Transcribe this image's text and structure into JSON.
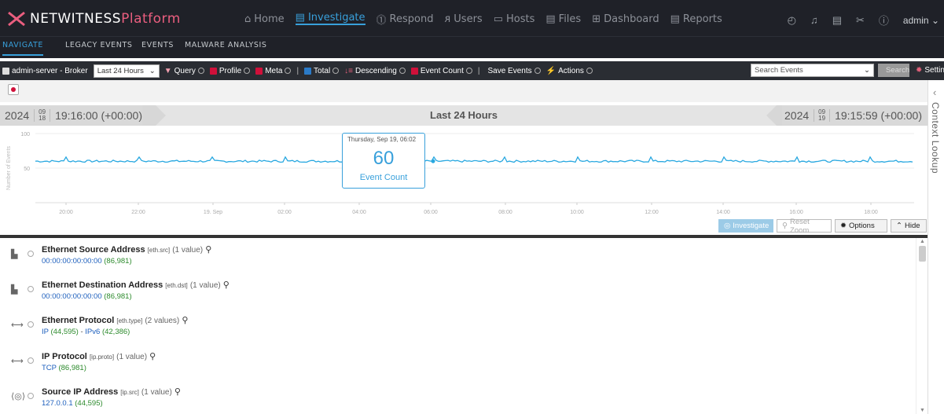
{
  "brand": {
    "name": "NETWITNESS",
    "platform": "Platform"
  },
  "mainnav": [
    {
      "label": "Home",
      "icon": "home-icon"
    },
    {
      "label": "Investigate",
      "icon": "investigate-icon"
    },
    {
      "label": "Respond",
      "icon": "respond-icon"
    },
    {
      "label": "Users",
      "icon": "users-icon"
    },
    {
      "label": "Hosts",
      "icon": "hosts-icon"
    },
    {
      "label": "Files",
      "icon": "files-icon"
    },
    {
      "label": "Dashboard",
      "icon": "dashboard-icon"
    },
    {
      "label": "Reports",
      "icon": "reports-icon"
    }
  ],
  "user": {
    "name": "admin"
  },
  "subnav": [
    "NAVIGATE",
    "LEGACY EVENTS",
    "EVENTS",
    "MALWARE ANALYSIS"
  ],
  "toolbar": {
    "service": "admin-server - Broker",
    "time_range": "Last 24 Hours",
    "query": "Query",
    "profile": "Profile",
    "meta": "Meta",
    "total": "Total",
    "descending": "Descending",
    "event_count": "Event Count",
    "save_events": "Save Events",
    "actions": "Actions",
    "search_placeholder": "Search Events",
    "search_button": "Search",
    "settings": "Settings"
  },
  "timeline": {
    "start_year": "2024",
    "start_month": "09",
    "start_day": "18",
    "start_time": "19:16:00 (+00:00)",
    "title": "Last 24 Hours",
    "end_year": "2024",
    "end_month": "09",
    "end_day": "19",
    "end_time": "19:15:59 (+00:00)"
  },
  "context_lookup": "Context Lookup",
  "chart_data": {
    "type": "line",
    "ylabel": "Number of Events",
    "yticks": [
      "100",
      "50"
    ],
    "ylim": [
      0,
      100
    ],
    "xticks": [
      "20:00",
      "22:00",
      "19. Sep",
      "02:00",
      "04:00",
      "06:00",
      "08:00",
      "10:00",
      "12:00",
      "14:00",
      "16:00",
      "18:00"
    ],
    "baseline": 60,
    "tooltip": {
      "date": "Thursday, Sep 19, 06:02",
      "value": "60",
      "label": "Event Count"
    },
    "color": "#29a8e0"
  },
  "chart_buttons": {
    "investigate": "Investigate",
    "reset_zoom": "Reset Zoom",
    "options": "Options",
    "hide": "Hide"
  },
  "meta_keys": [
    {
      "icon": "network-device-icon",
      "title": "Ethernet Source Address",
      "key": "[eth.src]",
      "count": "(1 value)",
      "values": [
        {
          "name": "00:00:00:00:00:00",
          "count": "(86,981)"
        }
      ]
    },
    {
      "icon": "network-device-icon",
      "title": "Ethernet Destination Address",
      "key": "[eth.dst]",
      "count": "(1 value)",
      "values": [
        {
          "name": "00:00:00:00:00:00",
          "count": "(86,981)"
        }
      ]
    },
    {
      "icon": "protocol-arrows-icon",
      "title": "Ethernet Protocol",
      "key": "[eth.type]",
      "count": "(2 values)",
      "values": [
        {
          "name": "IP",
          "count": "(44,595)"
        },
        {
          "name": "IPv6",
          "count": "(42,386)"
        }
      ]
    },
    {
      "icon": "protocol-arrows-icon",
      "title": "IP Protocol",
      "key": "[ip.proto]",
      "count": "(1 value)",
      "values": [
        {
          "name": "TCP",
          "count": "(86,981)"
        }
      ]
    },
    {
      "icon": "source-ip-icon",
      "title": "Source IP Address",
      "key": "[ip.src]",
      "count": "(1 value)",
      "values": [
        {
          "name": "127.0.0.1",
          "count": "(44,595)"
        }
      ]
    }
  ]
}
